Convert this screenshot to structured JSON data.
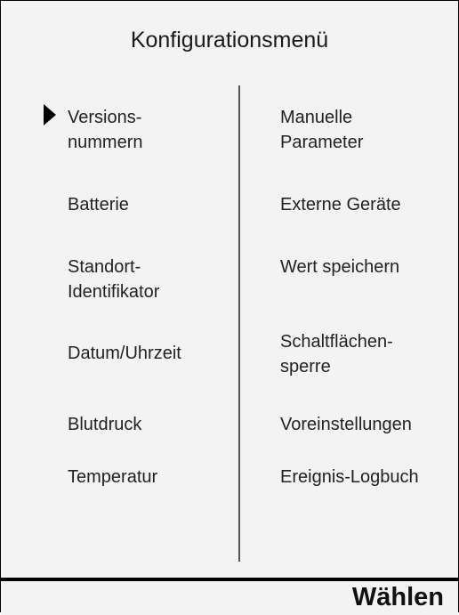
{
  "title": "Konfigurationsmenü",
  "left_items": [
    {
      "line1": "Versions-",
      "line2": "nummern"
    },
    {
      "line1": "Batterie",
      "line2": ""
    },
    {
      "line1": "Standort-",
      "line2": "Identifikator"
    },
    {
      "line1": "Datum/Uhrzeit",
      "line2": ""
    },
    {
      "line1": "Blutdruck",
      "line2": ""
    },
    {
      "line1": "Temperatur",
      "line2": ""
    }
  ],
  "right_items": [
    {
      "line1": "Manuelle",
      "line2": "Parameter"
    },
    {
      "line1": "Externe Geräte",
      "line2": ""
    },
    {
      "line1": "Wert speichern",
      "line2": ""
    },
    {
      "line1": "Schaltflächen-",
      "line2": "sperre"
    },
    {
      "line1": "Voreinstellungen",
      "line2": ""
    },
    {
      "line1": "Ereignis-Logbuch",
      "line2": ""
    }
  ],
  "softkey": {
    "label": "Wählen"
  },
  "cursor_icon": "triangle-right-icon"
}
